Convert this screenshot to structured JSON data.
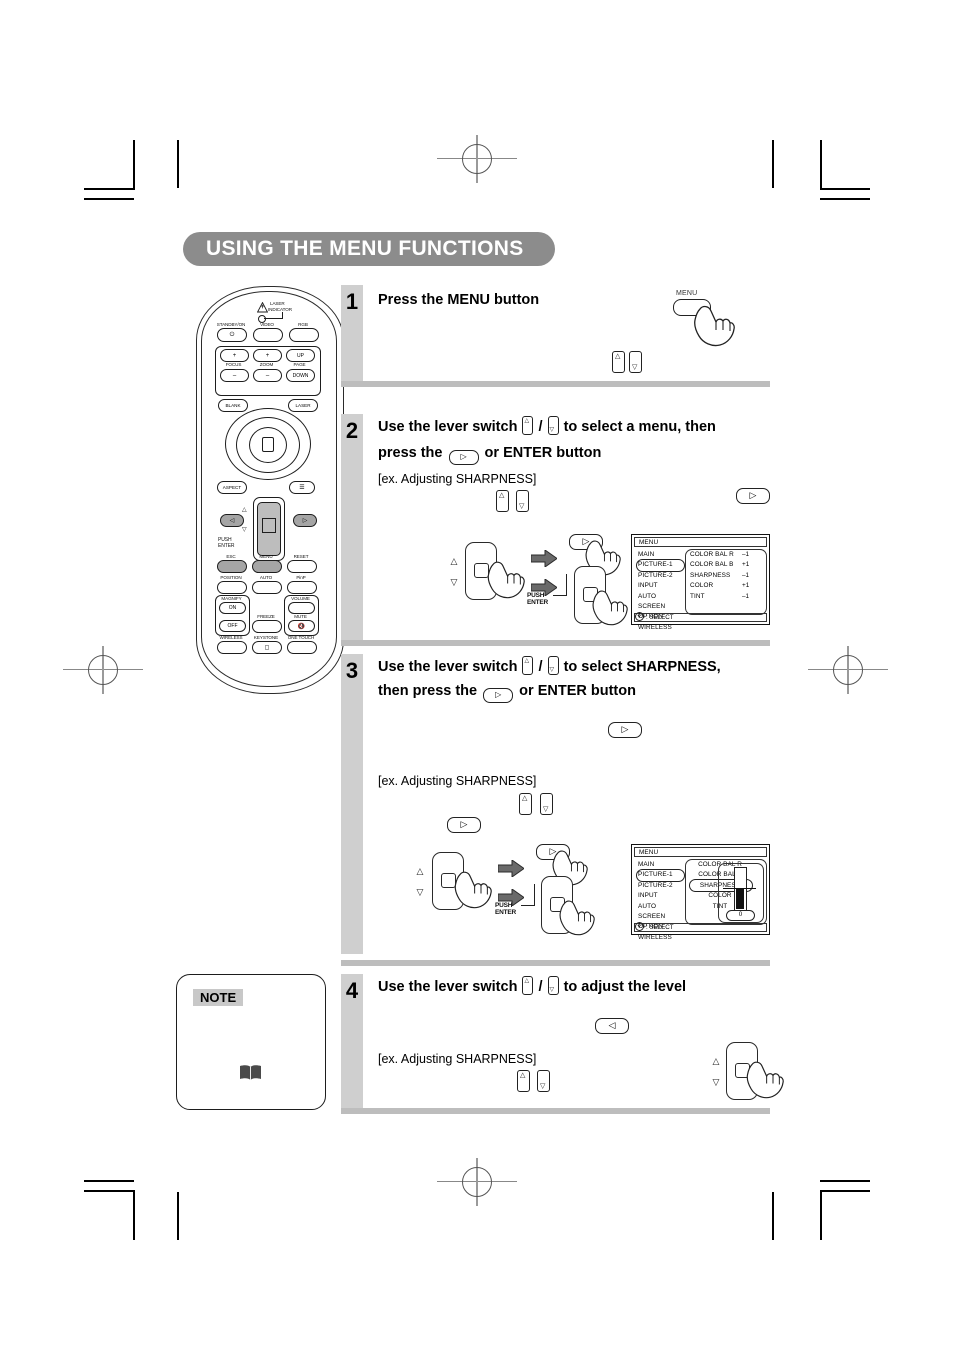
{
  "page": {
    "title": "USING THE MENU FUNCTIONS",
    "title_bg": "#8c8c8c",
    "step_column_bg": "#cfcfcf",
    "separator_bg": "#bdbdbd"
  },
  "remote": {
    "name": "projector-remote-control",
    "top_labels": {
      "laser": "LASER",
      "indicator": "INDICATOR"
    },
    "buttons": [
      {
        "label": "STANDBY/ON",
        "glyph": "⏻"
      },
      {
        "label": "VIDEO"
      },
      {
        "label": "RGB"
      },
      {
        "label": "FOCUS",
        "plus": "+",
        "minus": "–"
      },
      {
        "label": "ZOOM",
        "plus": "+",
        "minus": "–"
      },
      {
        "label": "PAGE",
        "up": "UP",
        "down": "DOWN"
      },
      {
        "label": "BLANK"
      },
      {
        "label": "LASER"
      },
      {
        "label": "ASPECT"
      },
      {
        "label": "ESC"
      },
      {
        "label": "MENU"
      },
      {
        "label": "RESET"
      },
      {
        "label": "POSITION"
      },
      {
        "label": "AUTO"
      },
      {
        "label": "PinP"
      },
      {
        "label": "MAGNIFY",
        "on": "ON",
        "off": "OFF"
      },
      {
        "label": "FREEZE"
      },
      {
        "label": "VOLUME"
      },
      {
        "label": "MUTE"
      },
      {
        "label": "WIRELESS"
      },
      {
        "label": "KEYSTONE"
      },
      {
        "label": "ONE TOUCH"
      }
    ],
    "lever_marks": {
      "up": "△",
      "down": "▽"
    },
    "push_enter": "PUSH\nENTER"
  },
  "steps": [
    {
      "number": "1",
      "headline_parts": [
        "Press the MENU button"
      ],
      "callout_label": "MENU"
    },
    {
      "number": "2",
      "line1_a": "Use the lever switch",
      "line1_b": "/",
      "line1_c": "to select a menu, then",
      "line2_a": "press the",
      "line2_btn": "▷",
      "line2_c": "or ENTER button",
      "example": "[ex. Adjusting SHARPNESS]",
      "push_enter": "PUSH",
      "push_enter2": "ENTER"
    },
    {
      "number": "3",
      "line1_a": "Use the lever switch",
      "line1_b": "/",
      "line1_c": "to select SHARPNESS,",
      "line2_a": "then press the",
      "line2_btn": "▷",
      "line2_c": "or ENTER button",
      "example": "[ex. Adjusting SHARPNESS]",
      "push_enter": "PUSH",
      "push_enter2": "ENTER"
    },
    {
      "number": "4",
      "line1_a": "Use the lever switch",
      "line1_b": "/",
      "line1_c": "to adjust the level",
      "btn": "◁",
      "example": "[ex. Adjusting SHARPNESS]"
    }
  ],
  "osd_step2": {
    "header": "MENU",
    "left_items": [
      "MAIN",
      "PICTURE-1",
      "PICTURE-2",
      "INPUT",
      "AUTO",
      "SCREEN",
      "OPTION",
      "WIRELESS"
    ],
    "selected_left": "PICTURE-1",
    "right_items": [
      {
        "label": "COLOR BAL R",
        "value": "–1"
      },
      {
        "label": "COLOR BAL B",
        "value": "+1"
      },
      {
        "label": "SHARPNESS",
        "value": "–1"
      },
      {
        "label": "COLOR",
        "value": "+1"
      },
      {
        "label": "TINT",
        "value": "–1"
      }
    ],
    "footer": ": SELECT",
    "footer_icon": "✣"
  },
  "osd_step3": {
    "header": "MENU",
    "left_items": [
      "MAIN",
      "PICTURE-1",
      "PICTURE-2",
      "INPUT",
      "AUTO",
      "SCREEN",
      "OPTION",
      "WIRELESS"
    ],
    "selected_left": "PICTURE-1",
    "right_items": [
      "COLOR BAL R",
      "COLOR BAL B",
      "SHARPNESS",
      "COLOR",
      "TINT"
    ],
    "selected_right": "SHARPNESS",
    "slider_value": "0",
    "footer": ": SELECT",
    "footer_icon": "✣"
  },
  "note": {
    "label": "NOTE",
    "book_icon": "book-icon"
  }
}
